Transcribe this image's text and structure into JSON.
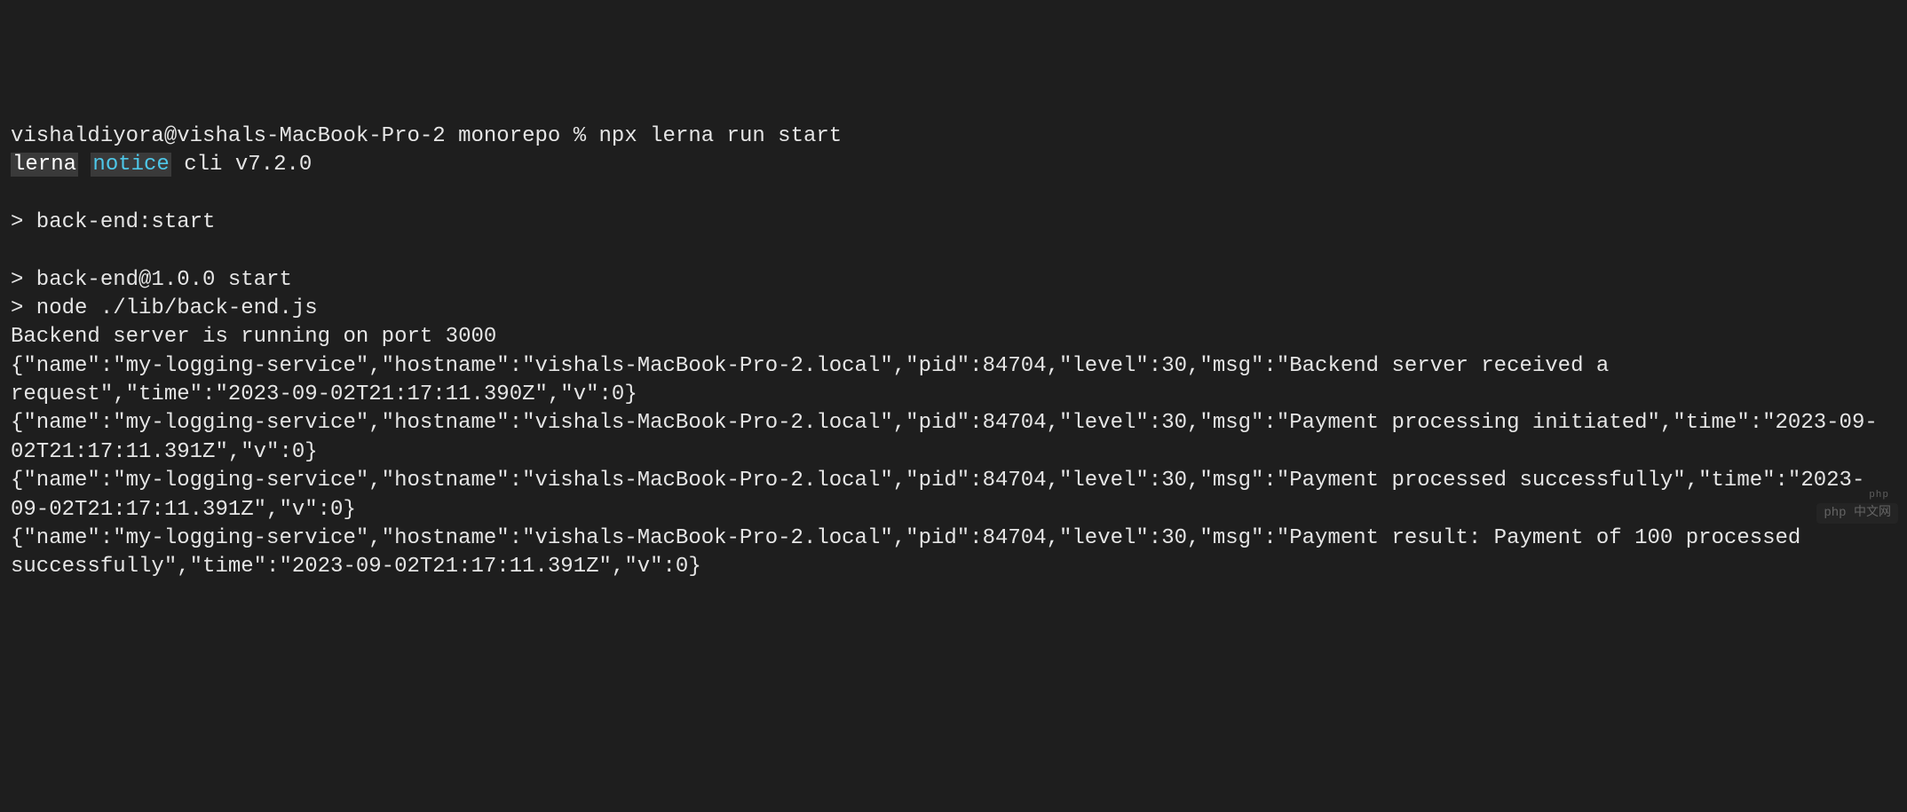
{
  "prompt": {
    "user_host": "vishaldiyora@vishals-MacBook-Pro-2",
    "directory": "monorepo",
    "symbol": "%",
    "command": "npx lerna run start"
  },
  "lerna_line": {
    "tag1": "lerna",
    "tag2": "notice",
    "rest": " cli v7.2.0"
  },
  "lines": {
    "l1": "> back-end:start",
    "l2": "> back-end@1.0.0 start",
    "l3": "> node ./lib/back-end.js",
    "l4": "Backend server is running on port 3000",
    "l5": "{\"name\":\"my-logging-service\",\"hostname\":\"vishals-MacBook-Pro-2.local\",\"pid\":84704,\"level\":30,\"msg\":\"Backend server received a request\",\"time\":\"2023-09-02T21:17:11.390Z\",\"v\":0}",
    "l6": "{\"name\":\"my-logging-service\",\"hostname\":\"vishals-MacBook-Pro-2.local\",\"pid\":84704,\"level\":30,\"msg\":\"Payment processing initiated\",\"time\":\"2023-09-02T21:17:11.391Z\",\"v\":0}",
    "l7": "{\"name\":\"my-logging-service\",\"hostname\":\"vishals-MacBook-Pro-2.local\",\"pid\":84704,\"level\":30,\"msg\":\"Payment processed successfully\",\"time\":\"2023-09-02T21:17:11.391Z\",\"v\":0}",
    "l8": "{\"name\":\"my-logging-service\",\"hostname\":\"vishals-MacBook-Pro-2.local\",\"pid\":84704,\"level\":30,\"msg\":\"Payment result: Payment of 100 processed successfully\",\"time\":\"2023-09-02T21:17:11.391Z\",\"v\":0}"
  },
  "watermark": {
    "label": "php",
    "sub": "中文网"
  }
}
